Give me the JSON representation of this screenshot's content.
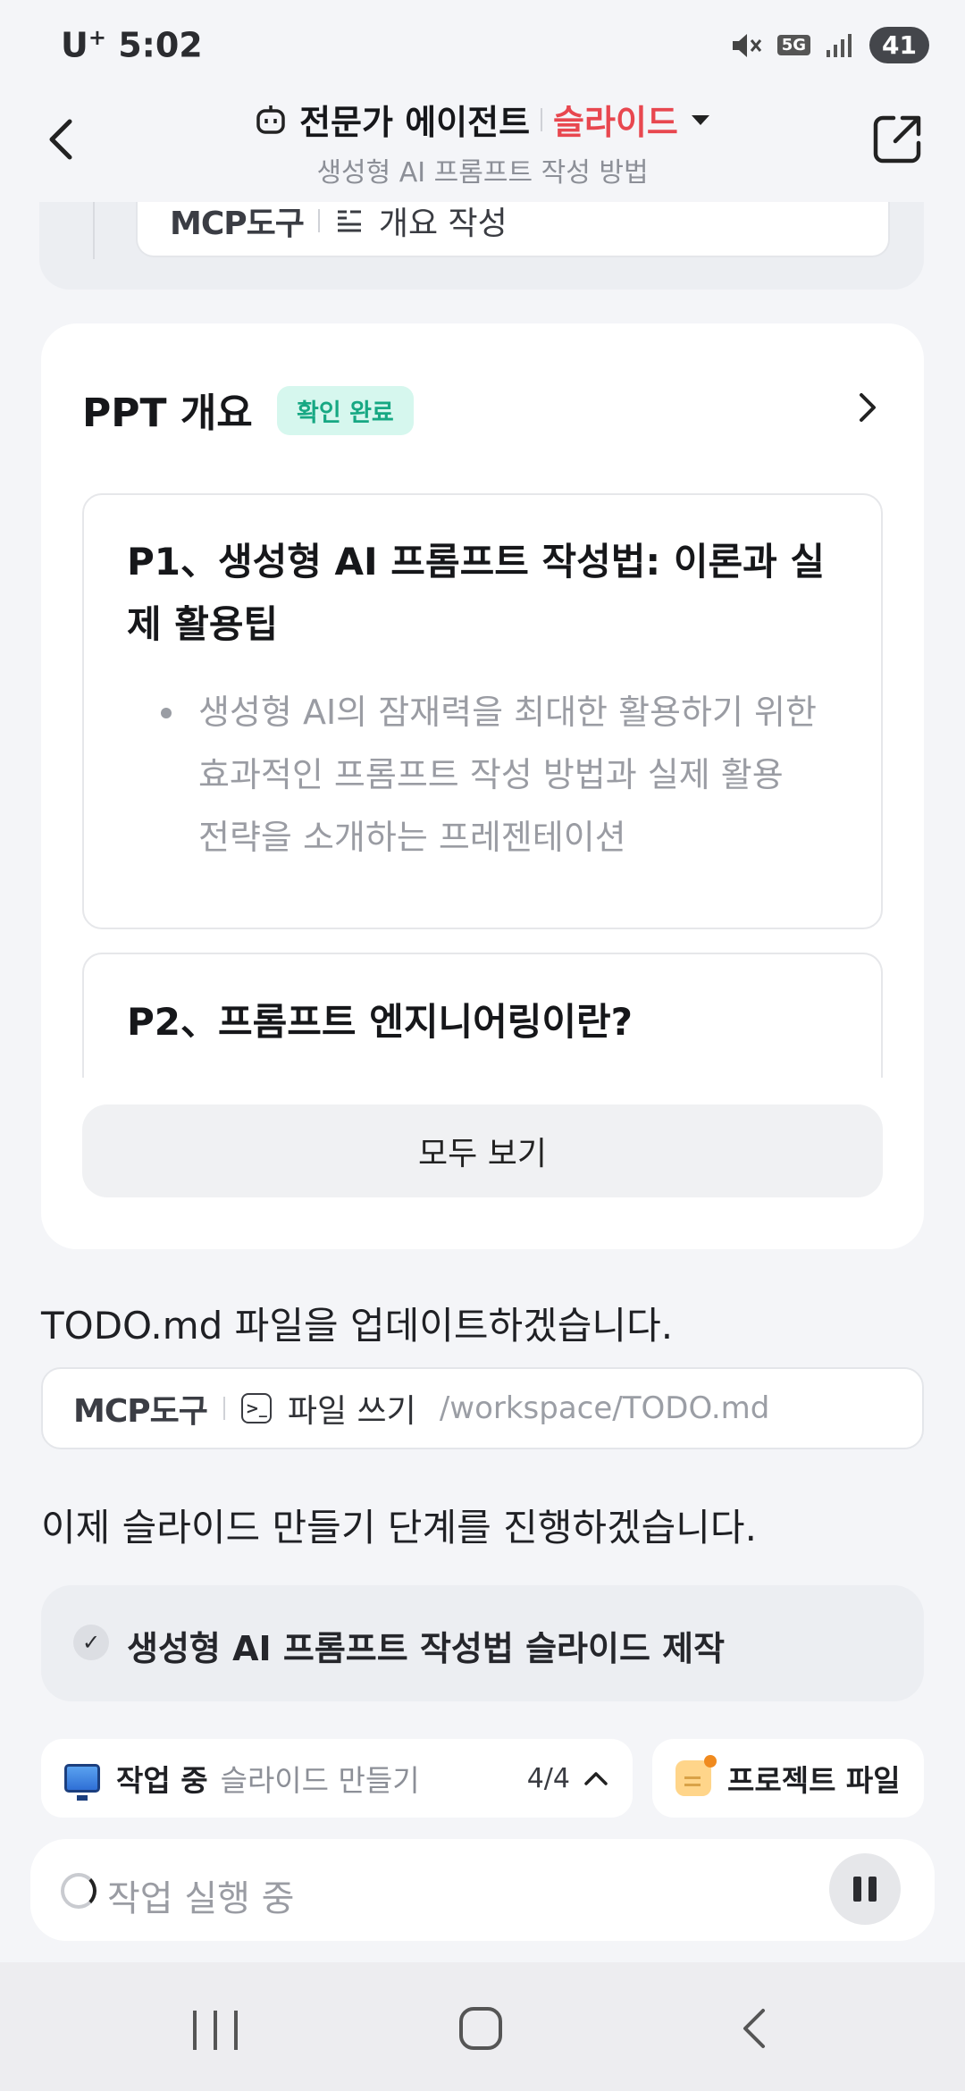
{
  "status_bar": {
    "carrier": "U",
    "carrier_sup": "+",
    "time": "5:02",
    "network": "5G",
    "battery": "41"
  },
  "header": {
    "title": "전문가 에이전트",
    "mode": "슬라이드",
    "subtitle": "생성형 AI 프롬프트 작성 방법"
  },
  "top_chip": {
    "logo": "MCP도구",
    "action": "개요 작성"
  },
  "outline": {
    "title": "PPT 개요",
    "badge": "확인 완료",
    "slides": [
      {
        "title": "P1、생성형 AI 프롬프트 작성법: 이론과 실제 활용팁",
        "bullet": "생성형 AI의 잠재력을 최대한 활용하기 위한 효과적인 프롬프트 작성 방법과 실제 활용 전략을 소개하는 프레젠테이션"
      },
      {
        "title": "P2、프롬프트 엔지니어링이란?"
      }
    ],
    "view_all": "모두 보기"
  },
  "messages": {
    "update_todo": "TODO.md 파일을 업데이트하겠습니다.",
    "file_tool": {
      "logo": "MCP도구",
      "action": "파일 쓰기",
      "path": "/workspace/TODO.md"
    },
    "next_step": "이제 슬라이드 만들기 단계를 진행하겠습니다.",
    "task": "생성형 AI 프롬프트 작성법 슬라이드 제작"
  },
  "bottom": {
    "work_status": "작업 중",
    "work_task": "슬라이드 만들기",
    "work_count": "4/4",
    "project_files": "프로젝트 파일",
    "input_placeholder": "작업 실행 중"
  },
  "icons": {
    "back": "chevron-left-icon",
    "share": "share-external-icon",
    "agent": "robot-icon",
    "dropdown": "caret-down-icon",
    "outline_tool": "outline-list-icon",
    "terminal": "terminal-icon",
    "check": "check-icon",
    "monitor": "monitor-icon",
    "folder": "folder-icon",
    "pause": "pause-icon"
  },
  "colors": {
    "accent": "#e8474f",
    "badge_bg": "#d6f7ee",
    "badge_text": "#17a883"
  }
}
